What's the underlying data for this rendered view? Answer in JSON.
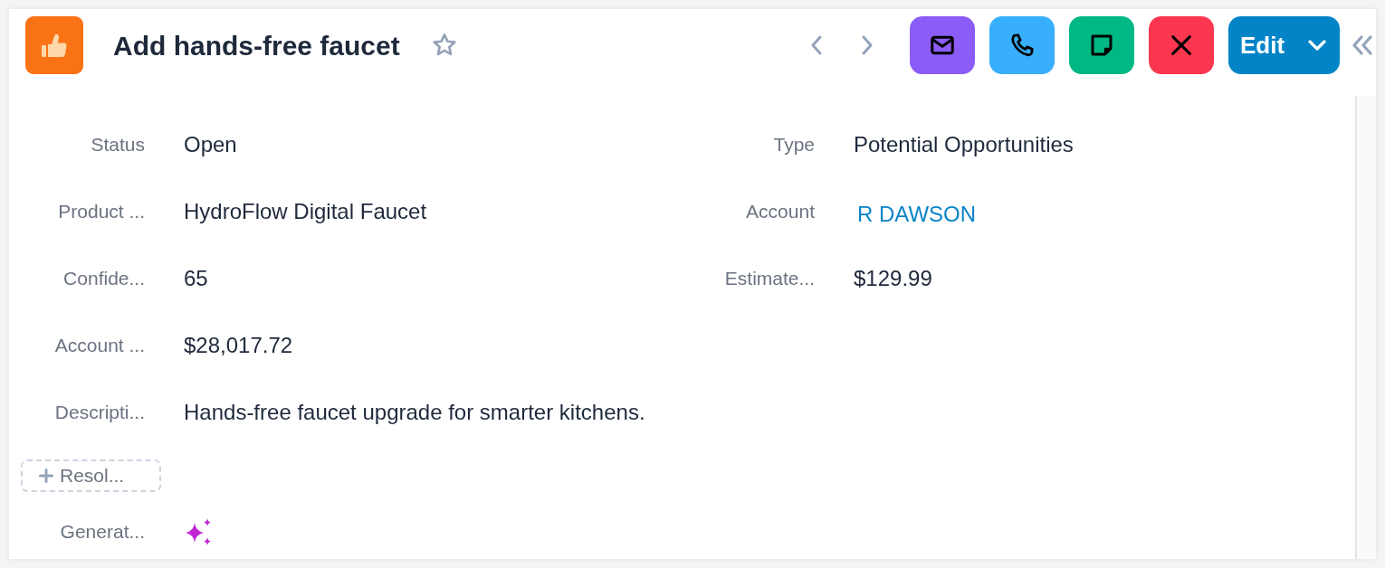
{
  "header": {
    "title": "Add hands-free faucet",
    "starred": false
  },
  "actions": [
    {
      "kind": "email",
      "color": "#8b5cf6"
    },
    {
      "kind": "call",
      "color": "#38affd"
    },
    {
      "kind": "note",
      "color": "#00b884"
    },
    {
      "kind": "close",
      "color": "#fb3750"
    }
  ],
  "edit_button": {
    "label": "Edit"
  },
  "field_rows": [
    [
      {
        "label": "Status",
        "kind": "text",
        "value": "Open"
      },
      {
        "label": "Type",
        "kind": "text",
        "value": "Potential Opportunities"
      }
    ],
    [
      {
        "label": "Product ...",
        "kind": "text",
        "value": "HydroFlow Digital Faucet"
      },
      {
        "label": "Account",
        "kind": "link",
        "value": "R DAWSON"
      }
    ],
    [
      {
        "label": "Confide...",
        "kind": "text",
        "value": "65"
      },
      {
        "label": "Estimate...",
        "kind": "text",
        "value": "$129.99"
      }
    ],
    [
      {
        "label": "Account ...",
        "kind": "text",
        "value": "$28,017.72"
      }
    ],
    [
      {
        "label": "Descripti...",
        "kind": "text",
        "value": "Hands-free faucet upgrade for smarter kitchens."
      }
    ]
  ],
  "add_field_button": {
    "label": "Resol..."
  },
  "generate_field": {
    "label": "Generat...",
    "kind": "ai"
  }
}
